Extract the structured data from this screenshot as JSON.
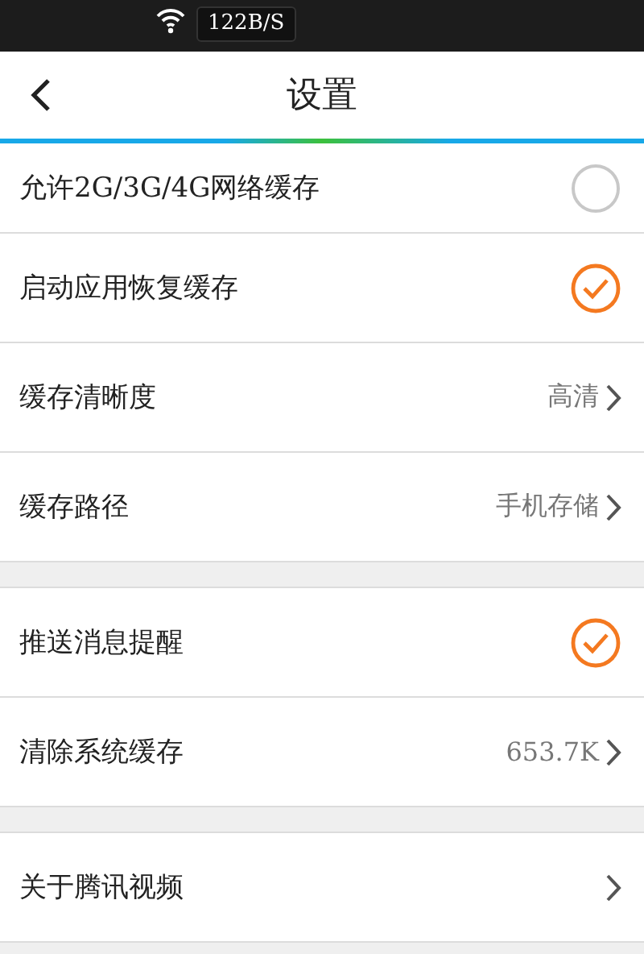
{
  "status_bar": {
    "speed": "122B/S"
  },
  "title_bar": {
    "title": "设置"
  },
  "groups": [
    {
      "items": [
        {
          "kind": "toggle",
          "label": "允许2G/3G/4G网络缓存",
          "checked": false
        },
        {
          "kind": "toggle",
          "label": "启动应用恢复缓存",
          "checked": true
        },
        {
          "kind": "value",
          "label": "缓存清晰度",
          "value": "高清"
        },
        {
          "kind": "value",
          "label": "缓存路径",
          "value": "手机存储"
        }
      ]
    },
    {
      "items": [
        {
          "kind": "toggle",
          "label": "推送消息提醒",
          "checked": true
        },
        {
          "kind": "value",
          "label": "清除系统缓存",
          "value": "653.7K"
        }
      ]
    },
    {
      "items": [
        {
          "kind": "link",
          "label": "关于腾讯视频"
        }
      ]
    }
  ]
}
